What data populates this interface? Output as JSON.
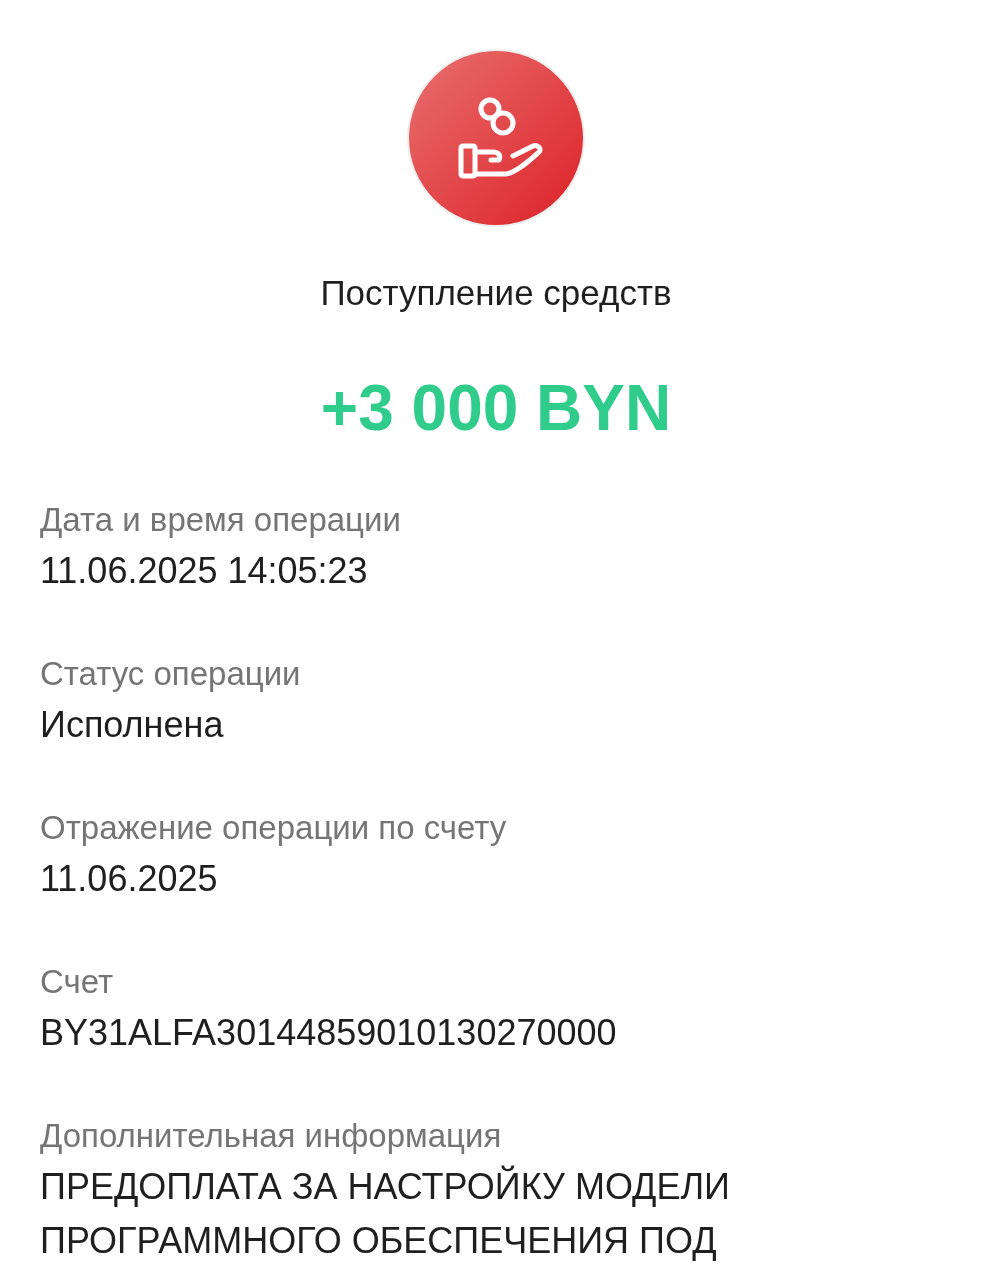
{
  "title": "Поступление средств",
  "amount": "+3 000 BYN",
  "fields": [
    {
      "label": "Дата и время операции",
      "value": "11.06.2025 14:05:23"
    },
    {
      "label": "Статус операции",
      "value": "Исполнена"
    },
    {
      "label": "Отражение операции по счету",
      "value": "11.06.2025"
    },
    {
      "label": "Счет",
      "value": "BY31ALFA30144859010130270000"
    },
    {
      "label": "Дополнительная информация",
      "value": "ПРЕДОПЛАТА ЗА НАСТРОЙКУ МОДЕЛИ ПРОГРАММНОГО ОБЕСПЕЧЕНИЯ ПОД"
    }
  ]
}
